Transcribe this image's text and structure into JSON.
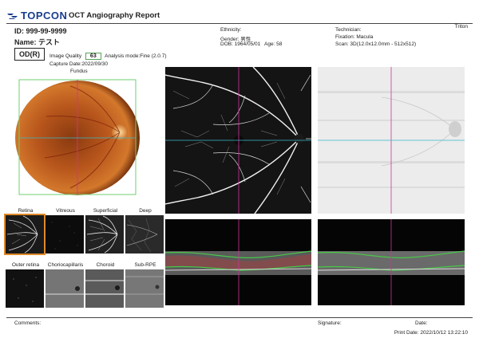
{
  "header": {
    "brand": "TOPCON",
    "title": "OCT Angiography Report",
    "product": "Triton"
  },
  "patient": {
    "id_label": "ID: 999-99-9999",
    "name_label": "Name: テスト",
    "eye": "OD(R)",
    "image_quality_label": "Image Quality",
    "image_quality_value": "63",
    "analysis_mode": "Analysis mode:Fine (2.0.7)",
    "capture_date": "Capture Date:2022/09/30"
  },
  "demographics": {
    "ethnicity": "Ethnicity:",
    "gender": "Gender: 男性",
    "dob": "DOB: 1964/05/01",
    "age": "Age: 58"
  },
  "scan_info": {
    "technician": "Technician:",
    "fixation": "Fixation: Macula",
    "scan": "Scan: 3D(12.0x12.0mm - 512x512)"
  },
  "fundus": {
    "label": "Fundus"
  },
  "thumbnails": [
    {
      "label": "Retina"
    },
    {
      "label": "Vitreous"
    },
    {
      "label": "Superficial"
    },
    {
      "label": "Deep"
    },
    {
      "label": "Outer retina"
    },
    {
      "label": "Choriocapillaris"
    },
    {
      "label": "Choroid"
    },
    {
      "label": "Sub-RPE"
    }
  ],
  "footer": {
    "comments": "Comments:",
    "signature": "Signature:",
    "date": "Date:",
    "print_date": "Print Date: 2022/10/12 13:22:10"
  },
  "colors": {
    "brand": "#1a3c8e",
    "crosshair_vertical": "#d0349a",
    "crosshair_horizontal": "#38b8c8",
    "selected_thumb": "#e08a2a",
    "fundus_frame": "#6fcf6f"
  }
}
